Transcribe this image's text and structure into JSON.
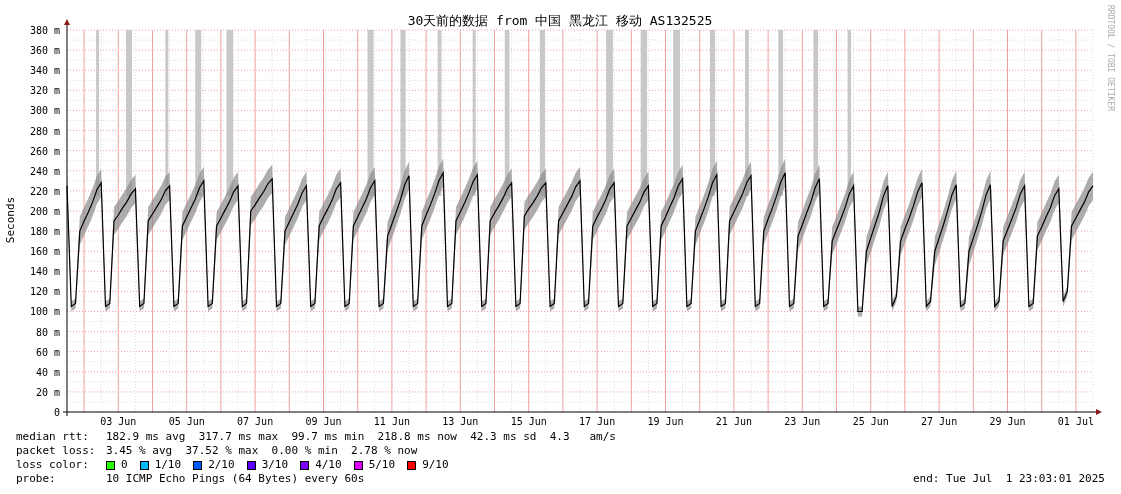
{
  "chart": {
    "credit": "RRDTOOL / TOBI OETIKER",
    "chart_data": {
      "type": "line",
      "title": "30天前的数据 from 中国 黑龙江 移动 AS132525",
      "ylabel": "Seconds",
      "ylim": [
        0,
        380
      ],
      "grid": true,
      "yticks": [
        {
          "value": 0,
          "label": "0"
        },
        {
          "value": 20,
          "label": "20 m"
        },
        {
          "value": 40,
          "label": "40 m"
        },
        {
          "value": 60,
          "label": "60 m"
        },
        {
          "value": 80,
          "label": "80 m"
        },
        {
          "value": 100,
          "label": "100 m"
        },
        {
          "value": 120,
          "label": "120 m"
        },
        {
          "value": 140,
          "label": "140 m"
        },
        {
          "value": 160,
          "label": "160 m"
        },
        {
          "value": 180,
          "label": "180 m"
        },
        {
          "value": 200,
          "label": "200 m"
        },
        {
          "value": 220,
          "label": "220 m"
        },
        {
          "value": 240,
          "label": "240 m"
        },
        {
          "value": 260,
          "label": "260 m"
        },
        {
          "value": 280,
          "label": "280 m"
        },
        {
          "value": 300,
          "label": "300 m"
        },
        {
          "value": 320,
          "label": "320 m"
        },
        {
          "value": 340,
          "label": "340 m"
        },
        {
          "value": 360,
          "label": "360 m"
        },
        {
          "value": 380,
          "label": "380 m"
        }
      ],
      "categories": [
        null,
        null,
        null,
        null,
        null,
        null,
        null,
        null,
        null,
        null,
        null,
        null,
        "03 Jun",
        null,
        null,
        null,
        null,
        null,
        null,
        null,
        null,
        null,
        null,
        null,
        null,
        null,
        null,
        null,
        "05 Jun",
        null,
        null,
        null,
        null,
        null,
        null,
        null,
        null,
        null,
        null,
        null,
        null,
        null,
        null,
        null,
        "07 Jun",
        null,
        null,
        null,
        null,
        null,
        null,
        null,
        null,
        null,
        null,
        null,
        null,
        null,
        null,
        null,
        "09 Jun",
        null,
        null,
        null,
        null,
        null,
        null,
        null,
        null,
        null,
        null,
        null,
        null,
        null,
        null,
        null,
        "11 Jun",
        null,
        null,
        null,
        null,
        null,
        null,
        null,
        null,
        null,
        null,
        null,
        null,
        null,
        null,
        null,
        "13 Jun",
        null,
        null,
        null,
        null,
        null,
        null,
        null,
        null,
        null,
        null,
        null,
        null,
        null,
        null,
        null,
        "15 Jun",
        null,
        null,
        null,
        null,
        null,
        null,
        null,
        null,
        null,
        null,
        null,
        null,
        null,
        null,
        null,
        "17 Jun",
        null,
        null,
        null,
        null,
        null,
        null,
        null,
        null,
        null,
        null,
        null,
        null,
        null,
        null,
        null,
        "19 Jun",
        null,
        null,
        null,
        null,
        null,
        null,
        null,
        null,
        null,
        null,
        null,
        null,
        null,
        null,
        null,
        "21 Jun",
        null,
        null,
        null,
        null,
        null,
        null,
        null,
        null,
        null,
        null,
        null,
        null,
        null,
        null,
        null,
        "23 Jun",
        null,
        null,
        null,
        null,
        null,
        null,
        null,
        null,
        null,
        null,
        null,
        null,
        null,
        null,
        null,
        "25 Jun",
        null,
        null,
        null,
        null,
        null,
        null,
        null,
        null,
        null,
        null,
        null,
        null,
        null,
        null,
        null,
        "27 Jun",
        null,
        null,
        null,
        null,
        null,
        null,
        null,
        null,
        null,
        null,
        null,
        null,
        null,
        null,
        null,
        "29 Jun",
        null,
        null,
        null,
        null,
        null,
        null,
        null,
        null,
        null,
        null,
        null,
        null,
        null,
        null,
        null,
        "01 Jul",
        null,
        null,
        null,
        null
      ],
      "series": [
        {
          "color": "#000000",
          "values": [
            225,
            105,
            108,
            180,
            190,
            199,
            209,
            221,
            228,
            105,
            108,
            190,
            196,
            203,
            209,
            217,
            222,
            105,
            108,
            190,
            197,
            204,
            211,
            220,
            225,
            105,
            108,
            185,
            194,
            203,
            212,
            223,
            230,
            105,
            108,
            185,
            193,
            201,
            209,
            219,
            225,
            105,
            108,
            200,
            206,
            213,
            219,
            227,
            232,
            105,
            108,
            180,
            189,
            198,
            207,
            218,
            225,
            105,
            108,
            185,
            194,
            202,
            211,
            222,
            228,
            105,
            108,
            185,
            194,
            203,
            212,
            223,
            230,
            105,
            108,
            175,
            187,
            199,
            211,
            226,
            235,
            105,
            108,
            185,
            196,
            206,
            217,
            230,
            238,
            105,
            108,
            190,
            199,
            208,
            218,
            229,
            236,
            105,
            108,
            190,
            198,
            205,
            213,
            222,
            228,
            105,
            108,
            195,
            202,
            208,
            215,
            223,
            228,
            105,
            108,
            190,
            198,
            206,
            214,
            224,
            230,
            105,
            108,
            185,
            194,
            202,
            211,
            222,
            228,
            105,
            108,
            185,
            193,
            201,
            209,
            219,
            225,
            105,
            108,
            185,
            194,
            204,
            213,
            225,
            232,
            105,
            108,
            180,
            191,
            202,
            214,
            228,
            236,
            105,
            108,
            190,
            199,
            208,
            217,
            228,
            235,
            105,
            108,
            180,
            192,
            203,
            215,
            229,
            238,
            105,
            108,
            175,
            186,
            198,
            209,
            223,
            232,
            105,
            108,
            170,
            181,
            192,
            203,
            217,
            225,
            100,
            100,
            160,
            173,
            186,
            199,
            215,
            225,
            105,
            115,
            170,
            182,
            193,
            205,
            219,
            228,
            105,
            110,
            160,
            173,
            186,
            200,
            216,
            226,
            105,
            108,
            160,
            173,
            186,
            200,
            216,
            226,
            105,
            110,
            170,
            181,
            192,
            203,
            217,
            225,
            105,
            108,
            175,
            184,
            194,
            203,
            215,
            222,
            110,
            120,
            185,
            193,
            201,
            209,
            219,
            225
          ]
        }
      ]
    }
  },
  "legend": {
    "median_rtt": {
      "label": "median rtt:",
      "value": "182.9 ms avg  317.7 ms max  99.7 ms min  218.8 ms now  42.3 ms sd  4.3   am/s"
    },
    "packet_loss": {
      "label": "packet loss:",
      "value": "3.45 % avg  37.52 % max  0.00 % min  2.78 % now"
    },
    "loss_color": {
      "label": "loss color:",
      "items": [
        {
          "label": "0",
          "color": "#26ff00"
        },
        {
          "label": "1/10",
          "color": "#00b8ff"
        },
        {
          "label": "2/10",
          "color": "#0059ff"
        },
        {
          "label": "3/10",
          "color": "#5e00ff"
        },
        {
          "label": "4/10",
          "color": "#7e00ff"
        },
        {
          "label": "5/10",
          "color": "#dd00ff"
        },
        {
          "label": "9/10",
          "color": "#ff0000"
        }
      ]
    },
    "probe": {
      "label": "probe:",
      "value": "10 ICMP Echo Pings (64 Bytes) every 60s"
    },
    "end": "end: Tue Jul  1 23:03:01 2025"
  }
}
